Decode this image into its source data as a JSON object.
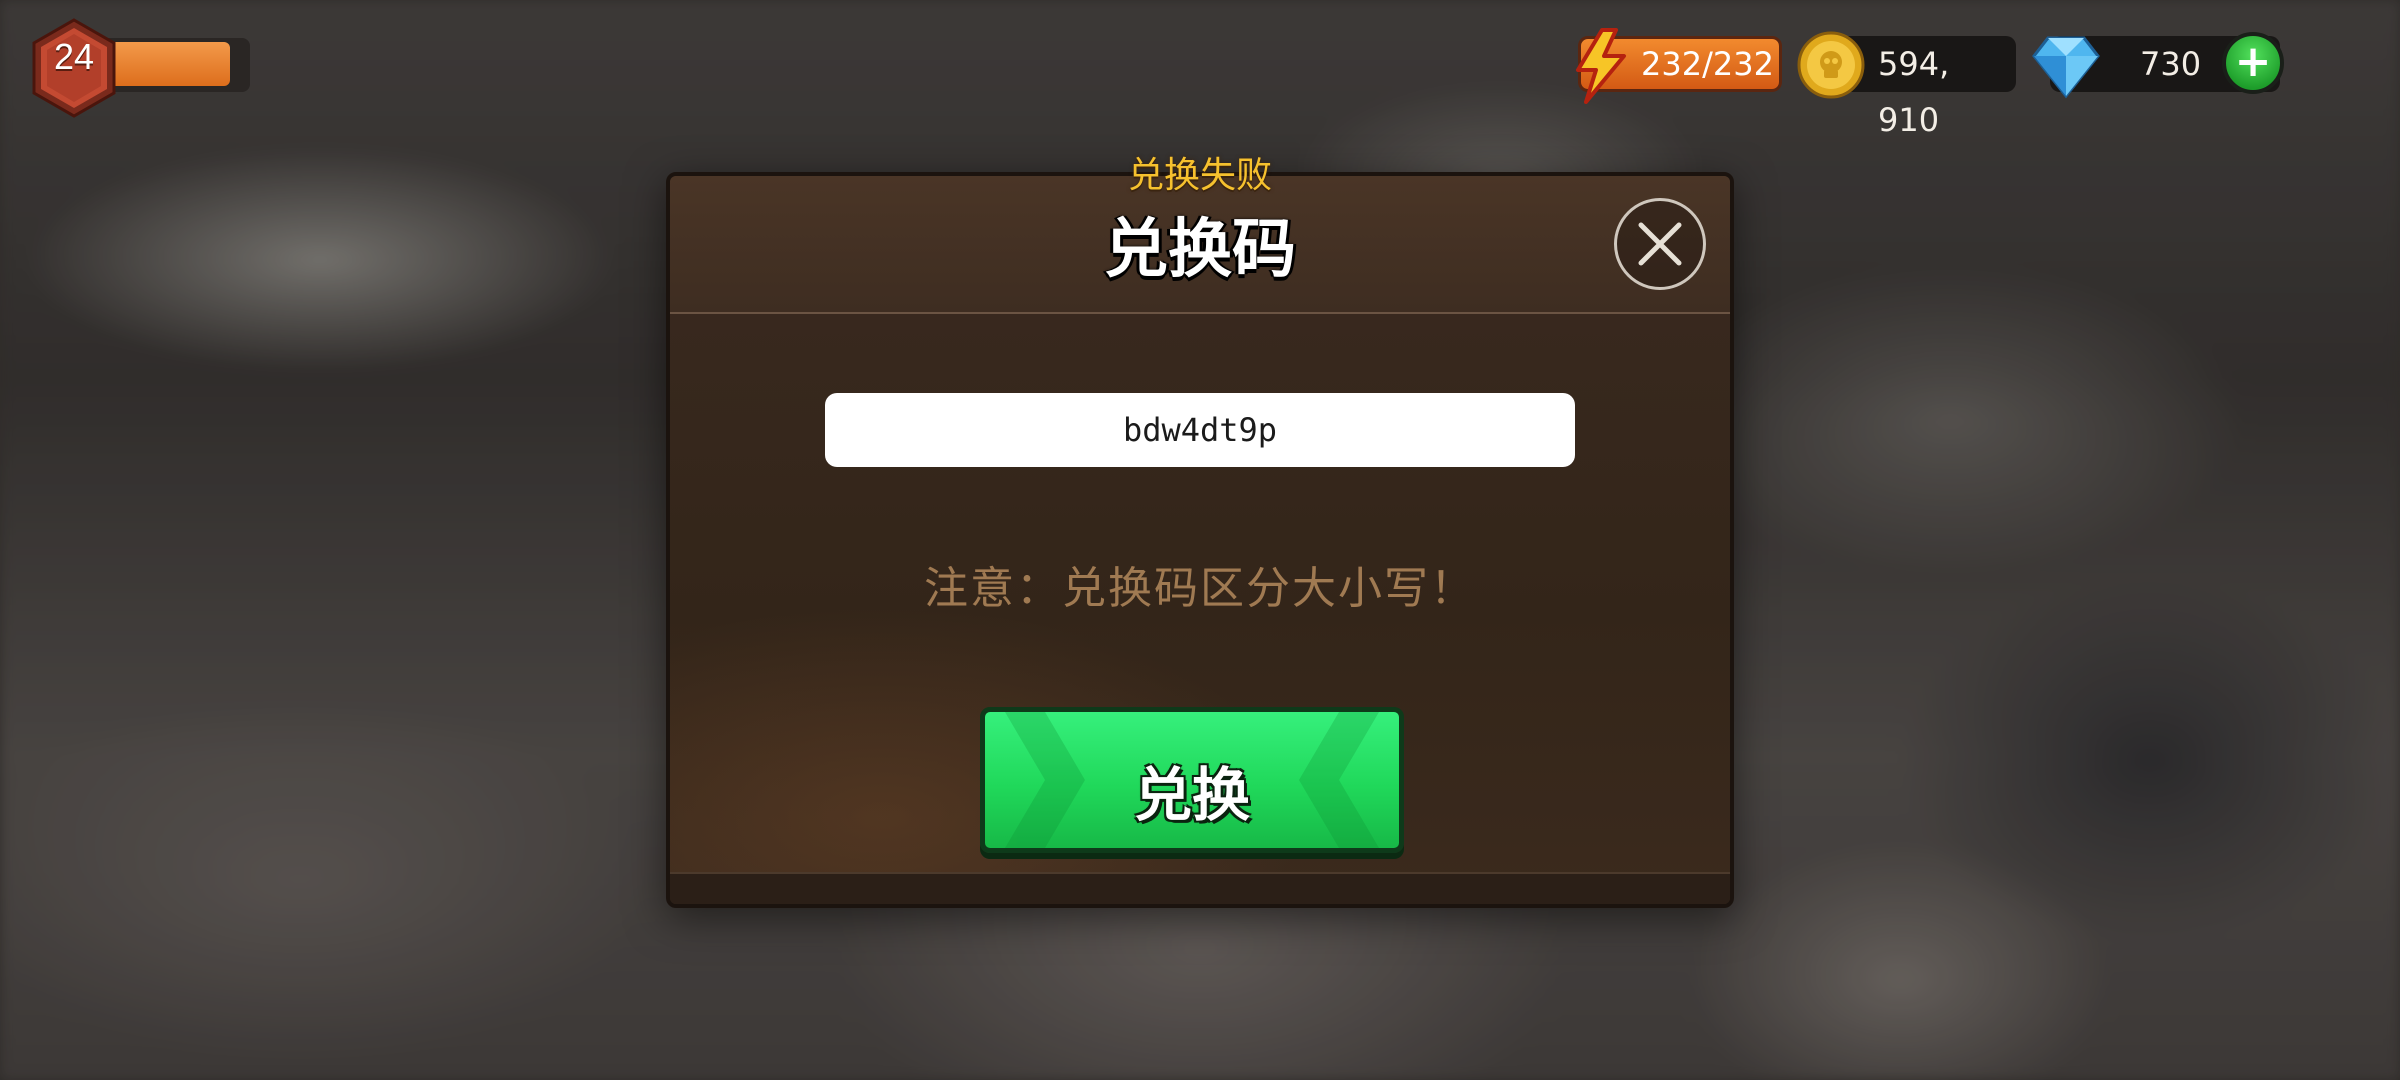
{
  "hud": {
    "level": "24",
    "energy": "232/232",
    "coins": "594, 910",
    "gems": "730"
  },
  "dialog": {
    "status": "兑换失败",
    "title": "兑换码",
    "code_value": "bdw4dt9p",
    "notice": "注意：兑换码区分大小写！",
    "redeem_label": "兑换"
  },
  "colors": {
    "status_text": "#f6c12e",
    "notice_text": "#a07a52",
    "redeem_button": "#20d85a",
    "energy_bar": "#e0742a"
  },
  "icons": {
    "level_badge": "hexagon-badge-icon",
    "energy": "lightning-icon",
    "coin": "skull-coin-icon",
    "gem": "diamond-icon",
    "add": "plus-icon",
    "close": "close-icon"
  }
}
